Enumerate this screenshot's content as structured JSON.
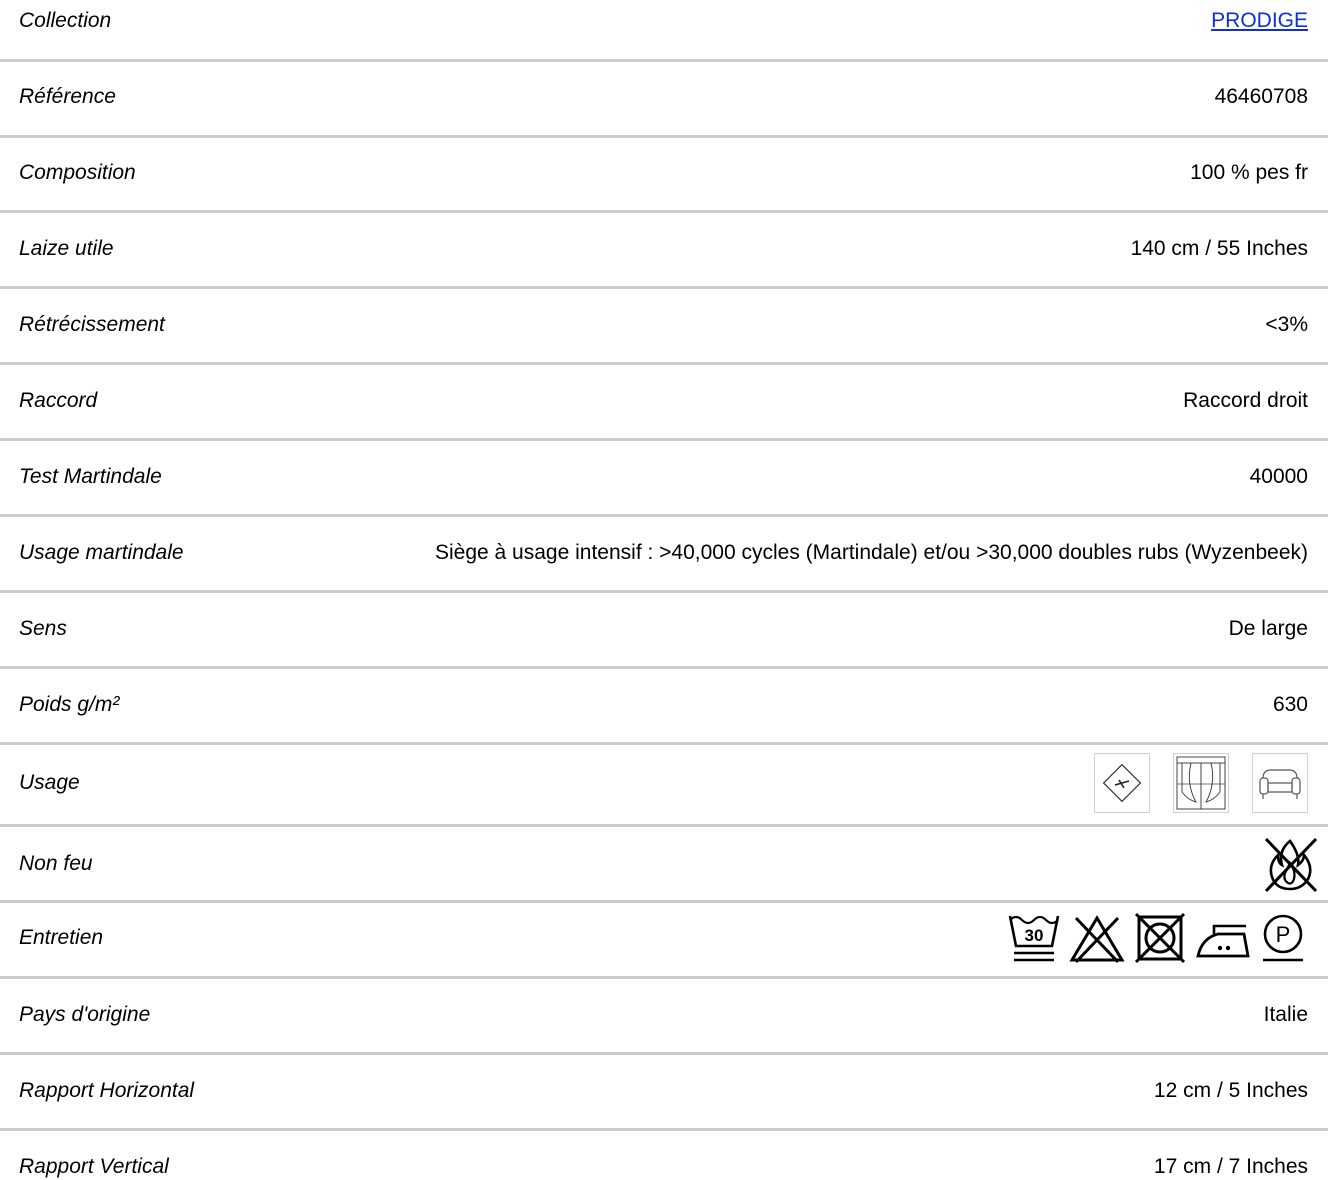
{
  "rows": [
    {
      "label": "Collection",
      "value": "PRODIGE",
      "link": true
    },
    {
      "label": "Référence",
      "value": "46460708"
    },
    {
      "label": "Composition",
      "value": "100 % pes fr"
    },
    {
      "label": "Laize utile",
      "value": "140 cm / 55 Inches"
    },
    {
      "label": "Rétrécissement",
      "value": "<3%"
    },
    {
      "label": "Raccord",
      "value": "Raccord droit"
    },
    {
      "label": "Test Martindale",
      "value": "40000"
    },
    {
      "label": "Usage martindale",
      "value": "Siège à usage intensif : >40,000 cycles (Martindale) et/ou >30,000 doubles rubs (Wyzenbeek)"
    },
    {
      "label": "Sens",
      "value": "De large"
    },
    {
      "label": "Poids g/m²",
      "value": "630"
    },
    {
      "label": "Usage",
      "icons": [
        "cushion-icon",
        "curtain-icon",
        "armchair-icon"
      ]
    },
    {
      "label": "Non feu",
      "icons": [
        "flame-retardant-icon"
      ]
    },
    {
      "label": "Entretien",
      "icons": [
        "wash-30-icon",
        "no-bleach-icon",
        "no-tumble-dry-icon",
        "iron-low-icon",
        "dry-clean-p-icon"
      ],
      "wash_temp": "30",
      "dry_clean_letter": "P"
    },
    {
      "label": "Pays d'origine",
      "value": "Italie"
    },
    {
      "label": "Rapport Horizontal",
      "value": "12 cm / 5 Inches"
    },
    {
      "label": "Rapport Vertical",
      "value": "17 cm / 7 Inches"
    }
  ],
  "colors": {
    "link": "#0d2fd8",
    "divider": "#cccccc",
    "text": "#000000"
  }
}
